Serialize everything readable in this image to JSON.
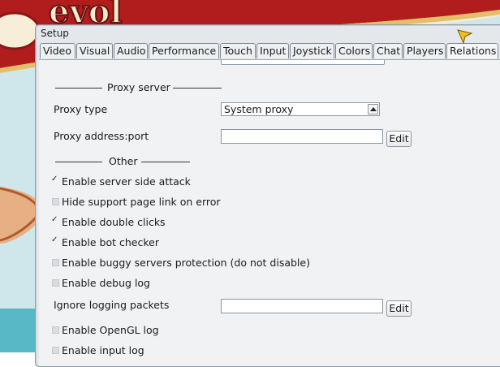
{
  "window": {
    "title": "Setup"
  },
  "tabs": [
    {
      "label": "Video"
    },
    {
      "label": "Visual"
    },
    {
      "label": "Audio"
    },
    {
      "label": "Performance"
    },
    {
      "label": "Touch"
    },
    {
      "label": "Input"
    },
    {
      "label": "Joystick"
    },
    {
      "label": "Colors"
    },
    {
      "label": "Chat"
    },
    {
      "label": "Players"
    },
    {
      "label": "Relations"
    }
  ],
  "proxy": {
    "section": "Proxy server",
    "type_label": "Proxy type",
    "type_value": "System proxy",
    "address_label": "Proxy address:port",
    "address_value": "",
    "edit_label": "Edit"
  },
  "other": {
    "section": "Other",
    "options": [
      {
        "label": "Enable server side attack",
        "checked": true
      },
      {
        "label": "Hide support page link on error",
        "checked": false
      },
      {
        "label": "Enable double clicks",
        "checked": true
      },
      {
        "label": "Enable bot checker",
        "checked": true
      },
      {
        "label": "Enable buggy servers protection (do not disable)",
        "checked": false
      },
      {
        "label": "Enable debug log",
        "checked": false
      }
    ],
    "ignore_label": "Ignore logging packets",
    "ignore_value": "",
    "edit_label": "Edit",
    "opengl_label": "Enable OpenGL log",
    "opengl_checked": false,
    "input_label": "Enable input log",
    "input_checked": false
  },
  "colors": {
    "sky": "#c8e4ea",
    "banner": "#b31e1e",
    "gold": "#e8c070"
  }
}
